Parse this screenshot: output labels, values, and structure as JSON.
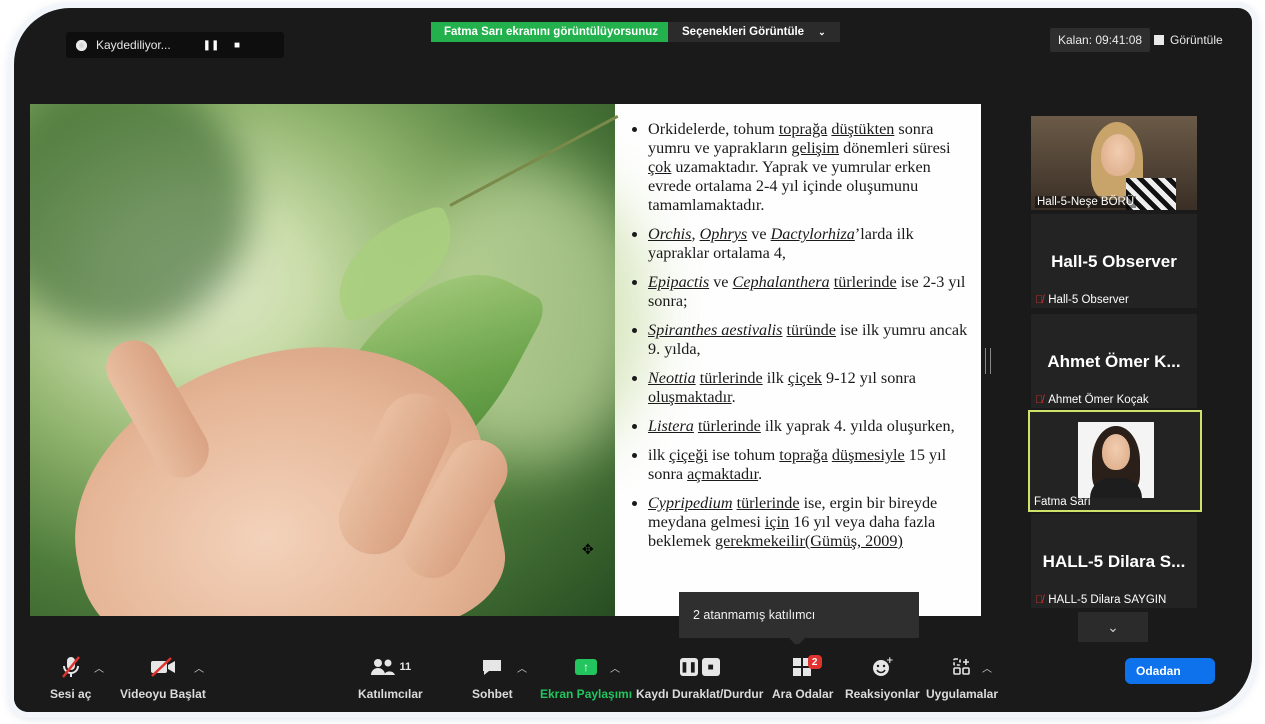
{
  "recording": {
    "label": "Kaydediliyor...",
    "pause_icon": "❚❚",
    "stop_icon": "■"
  },
  "banner": {
    "sharing": "Fatma Sarı ekranını görüntülüyorsunuz",
    "options": "Seçenekleri Görüntüle",
    "options_caret": "⌄"
  },
  "top_right": {
    "timer": "Kalan: 09:41:08",
    "view": "Görüntüle"
  },
  "slide": {
    "bullets": [
      {
        "html": "Orkidelerde, tohum <u>toprağa</u> <u>düştükten</u> sonra  yumru ve yaprakların <u>gelişim</u> dönemleri  süresi <u>çok</u> uzamaktadır. Yaprak ve yumrular erken evrede ortalama 2-4 yıl içinde oluşumunu tamamlamaktadır."
      },
      {
        "html": "<i><u>Orchis</u></i>, <i><u>Ophrys</u></i> ve <i><u>Dactylorhiza</u></i>’larda ilk yapraklar ortalama 4,"
      },
      {
        "html": "<i><u>Epipactis</u></i> ve <i><u>Cephalanthera</u></i> <u>türlerinde</u> ise 2-3 yıl sonra;"
      },
      {
        "html": " <i><u>Spiranthes aestivalis</u></i> <u>türünde</u> ise ilk yumru ancak 9. yılda,"
      },
      {
        "html": "<i><u>Neottia</u></i> <u>türlerinde</u> ilk <u>çiçek</u> 9-12 yıl sonra <u>oluşmaktadır</u>."
      },
      {
        "html": "<i><u>Listera</u></i> <u>türlerinde</u> ilk yaprak 4. yılda oluşurken,"
      },
      {
        "html": " ilk <u>çiçeği</u> ise tohum <u>toprağa</u> <u>düşmesiyle</u> 15 yıl sonra <u>açmaktadır</u>."
      },
      {
        "html": "<i><u>Cypripedium</u></i> <u>türlerinde</u> ise, ergin bir bireyde meydana gelmesi <u>için</u> 16 yıl veya daha fazla beklemek <u>gerekmekeilir(Gümüş, 2009)</u>"
      }
    ]
  },
  "participants": [
    {
      "name": "Hall-5-Neşe BÖRÜ",
      "video": true,
      "muted": false
    },
    {
      "display": "Hall-5 Observer",
      "name": "Hall-5 Observer",
      "muted": true
    },
    {
      "display": "Ahmet Ömer K...",
      "name": "Ahmet Ömer Koçak",
      "muted": true
    },
    {
      "name": "Fatma Sarı",
      "video": true,
      "muted": false,
      "active": true
    },
    {
      "display": "HALL-5 Dilara S...",
      "name": "HALL-5 Dilara SAYGIN",
      "muted": true
    }
  ],
  "participants_down": "⌄",
  "tooltip": "2 atanmamış katılımcı",
  "toolbar": {
    "mute": "Sesi aç",
    "video": "Videoyu Başlat",
    "participants": "Katılımcılar",
    "participants_count": "11",
    "chat": "Sohbet",
    "share": "Ekran Paylaşımı",
    "record": "Kaydı Duraklat/Durdur",
    "breakout": "Ara Odalar",
    "breakout_badge": "2",
    "reactions": "Reaksiyonlar",
    "apps": "Uygulamalar",
    "leave": "Odadan"
  },
  "colors": {
    "share_green": "#22b14c",
    "active_border": "#cfe36a",
    "leave_blue": "#0e72ed",
    "mute_red": "#e0332f"
  }
}
